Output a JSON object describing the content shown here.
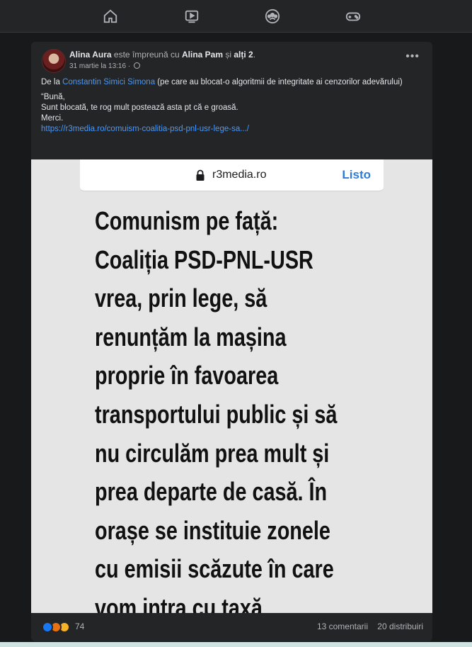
{
  "nav": {
    "icons": [
      "home-icon",
      "watch-icon",
      "groups-icon",
      "gaming-icon"
    ]
  },
  "post": {
    "author": "Alina Aura",
    "with_text": "este împreună cu",
    "with_person": "Alina Pam",
    "and_text": "și",
    "others": "alți 2",
    "period": ".",
    "timestamp": "31 martie la 13:16",
    "privacy_sep": "·",
    "more_label": "•••",
    "intro_prefix": "De la",
    "intro_link": "Constantin Simici Simona",
    "intro_suffix": "(pe care au blocat-o algoritmii de integritate ai cenzorilor adevărului)",
    "quote_line1": "“Bună,",
    "quote_line2": "Sunt blocată, te rog mult postează asta pt că e groasă.",
    "quote_line3": "Merci.",
    "link": "https://r3media.ro/comuism-coalitia-psd-pnl-usr-lege-sa.../"
  },
  "image": {
    "domain": "r3media.ro",
    "done_label": "Listo",
    "headline_lines": [
      "Comunism pe față:",
      "Coaliția PSD-PNL-USR",
      "vrea, prin lege, să",
      "renunțăm la mașina",
      "proprie în favoarea",
      "transportului public și să",
      "nu circulăm prea mult și",
      "prea departe de casă. În",
      "orașe se instituie zonele",
      "cu emisii scăzute în care",
      "vom intra cu taxă"
    ]
  },
  "footer": {
    "reaction_count": "74",
    "comments": "13 comentarii",
    "shares": "20 distribuiri"
  },
  "colors": {
    "background": "#18191a",
    "card": "#242526",
    "link": "#4599ff",
    "like": "#1877f2"
  }
}
